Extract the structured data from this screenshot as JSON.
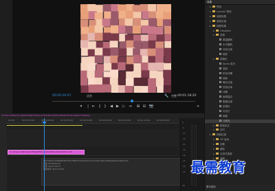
{
  "monitor": {
    "current_timecode": "00:00:26:07",
    "end_timecode": "00:01:18:20",
    "fit_label": "适合",
    "full_label": "完整"
  },
  "transport": {
    "buttons": [
      "▾",
      "|",
      "⇤",
      "{",
      "}",
      "◀",
      "▶",
      "▷",
      "⇥",
      "⊞",
      "⊟",
      "📷",
      "+"
    ]
  },
  "timeline": {
    "sequence_name": "05C8C7a9BdeA9ccB66d9o8Bf3a8e87dd7Bd3Bac8d5Bce8Bd87c8cB1a8e8Cd7F6Bd0d",
    "ticks": [
      "00:00",
      "00:00:10:00",
      "00:00:20:00",
      "00:00:30:00",
      "00:00:40:00",
      "00:00:50:00",
      "00:01:00:00",
      "00:01:10:00",
      "00:01:20:00"
    ],
    "clip_label": "fx [Video] 04BCa8ed7B8e8dFB6a6c8dbf8B1a6b8dcB8e7cd8",
    "info_lines": [
      "05C7a84e7234B0B9d0F7F6e7f8b8dc5b02bd0e7e7a7dc8e7b8e7a7B9Ae8e8c4ef6e4ad3",
      "开始: 00:00:00:00",
      "结束: 00:01:18:19",
      "持续时间: 00:01:18:20"
    ],
    "vu_labels": [
      "0",
      "-6",
      "-12",
      "-18",
      "-24",
      "-30",
      "-36",
      "-42",
      "-48",
      "-54",
      "dB"
    ]
  },
  "effects": {
    "header": "效果",
    "items": [
      {
        "label": "预设",
        "depth": 1,
        "type": "folder"
      },
      {
        "label": "Lumetri 预设",
        "depth": 1,
        "type": "folder"
      },
      {
        "label": "音频效果",
        "depth": 1,
        "type": "folder"
      },
      {
        "label": "音频过渡",
        "depth": 1,
        "type": "folder"
      },
      {
        "label": "视频效果",
        "depth": 1,
        "type": "folder"
      },
      {
        "label": "Obsolete",
        "depth": 2,
        "type": "folder"
      },
      {
        "label": "变换",
        "depth": 2,
        "type": "folder"
      },
      {
        "label": "垂直翻转",
        "depth": 3,
        "type": "fx"
      },
      {
        "label": "水平翻转",
        "depth": 3,
        "type": "fx"
      },
      {
        "label": "羽化边缘",
        "depth": 3,
        "type": "fx"
      },
      {
        "label": "裁剪",
        "depth": 3,
        "type": "fx"
      },
      {
        "label": "风格化",
        "depth": 2,
        "type": "folder"
      },
      {
        "label": "Alpha 发光",
        "depth": 3,
        "type": "fx"
      },
      {
        "label": "复制",
        "depth": 3,
        "type": "fx"
      },
      {
        "label": "彩色浮雕",
        "depth": 3,
        "type": "fx"
      },
      {
        "label": "抽帧",
        "depth": 3,
        "type": "fx"
      },
      {
        "label": "曝光过度",
        "depth": 3,
        "type": "fx"
      },
      {
        "label": "查找边缘",
        "depth": 3,
        "type": "fx"
      },
      {
        "label": "浮雕",
        "depth": 3,
        "type": "fx"
      },
      {
        "label": "画笔描边",
        "depth": 3,
        "type": "fx"
      },
      {
        "label": "粗糙边缘",
        "depth": 3,
        "type": "fx"
      },
      {
        "label": "纹理化",
        "depth": 3,
        "type": "fx"
      },
      {
        "label": "闪光灯",
        "depth": 3,
        "type": "fx"
      },
      {
        "label": "阈值",
        "depth": 3,
        "type": "fx"
      },
      {
        "label": "马赛克",
        "depth": 3,
        "type": "fx"
      },
      {
        "label": "颜色校正",
        "depth": 2,
        "type": "folder"
      },
      {
        "label": "过时",
        "depth": 2,
        "type": "folder"
      },
      {
        "label": "视频过渡",
        "depth": 1,
        "type": "folder"
      },
      {
        "label": "3D 运动",
        "depth": 2,
        "type": "folder"
      },
      {
        "label": "划像",
        "depth": 2,
        "type": "folder"
      },
      {
        "label": "擦除",
        "depth": 2,
        "type": "folder"
      },
      {
        "label": "沉浸式视频",
        "depth": 2,
        "type": "folder"
      },
      {
        "label": "溶解",
        "depth": 2,
        "type": "folder"
      },
      {
        "label": "滑动",
        "depth": 2,
        "type": "folder"
      },
      {
        "label": "缩放",
        "depth": 2,
        "type": "folder"
      },
      {
        "label": "页面剥落",
        "depth": 2,
        "type": "folder"
      }
    ],
    "selected_index": 24,
    "bottom_label": "基本图形"
  },
  "watermark": "最需教育",
  "colors": {
    "accent": "#2f8ee0",
    "clip": "#d95bd6",
    "watermark": "#0a39cf",
    "folder": "#cfa84a"
  }
}
